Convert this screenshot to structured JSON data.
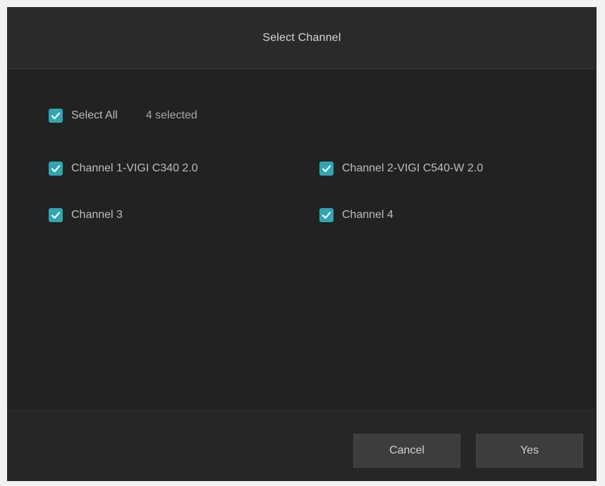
{
  "dialog": {
    "title": "Select Channel",
    "select_all": {
      "label": "Select All",
      "checked": true,
      "selected_count": "4 selected"
    },
    "channels": [
      {
        "label": "Channel 1-VIGI C340 2.0",
        "checked": true
      },
      {
        "label": "Channel 2-VIGI C540-W 2.0",
        "checked": true
      },
      {
        "label": "Channel 3",
        "checked": true
      },
      {
        "label": "Channel 4",
        "checked": true
      }
    ],
    "buttons": {
      "cancel": "Cancel",
      "yes": "Yes"
    }
  },
  "colors": {
    "background": "#222222",
    "checkbox_accent": "#2fa6b4",
    "button_bg": "#3d3d3d"
  }
}
